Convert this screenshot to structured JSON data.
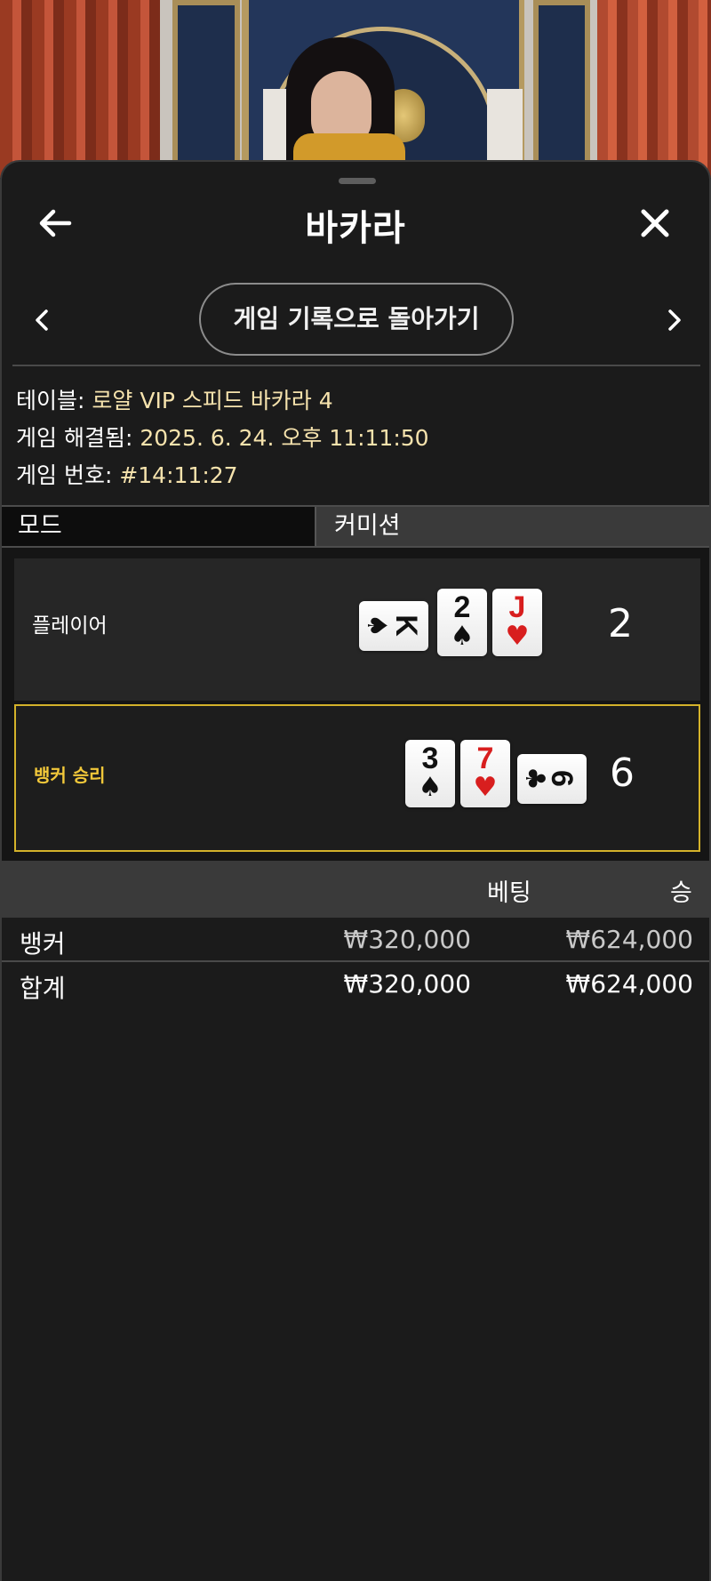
{
  "header": {
    "title": "바카라"
  },
  "nav": {
    "back_to_history_label": "게임 기록으로 돌아가기"
  },
  "info": {
    "table_label": "테이블:",
    "table_value": "로얄 VIP 스피드 바카라 4",
    "resolved_label": "게임 해결됨:",
    "resolved_value": "2025. 6. 24. 오후 11:11:50",
    "number_label": "게임 번호:",
    "number_value": "#14:11:27"
  },
  "tabs": {
    "mode": "모드",
    "commission": "커미션"
  },
  "results": {
    "player": {
      "label": "플레이어",
      "score": "2",
      "cards": [
        {
          "rank": "K",
          "suit": "♠",
          "color": "#111111",
          "orientation": "horizontal"
        },
        {
          "rank": "2",
          "suit": "♠",
          "color": "#111111",
          "orientation": "vertical"
        },
        {
          "rank": "J",
          "suit": "♥",
          "color": "#d81e1e",
          "orientation": "vertical"
        }
      ]
    },
    "banker": {
      "label": "뱅커 승리",
      "score": "6",
      "cards": [
        {
          "rank": "3",
          "suit": "♠",
          "color": "#111111",
          "orientation": "vertical"
        },
        {
          "rank": "7",
          "suit": "♥",
          "color": "#d81e1e",
          "orientation": "vertical"
        },
        {
          "rank": "6",
          "suit": "♣",
          "color": "#111111",
          "orientation": "horizontal"
        }
      ]
    },
    "winner_highlight_color": "#d4b22a"
  },
  "bets": {
    "columns": {
      "bet": "베팅",
      "win": "승"
    },
    "rows": [
      {
        "name": "뱅커",
        "bet": "₩320,000",
        "win": "₩624,000"
      }
    ],
    "total": {
      "name": "합계",
      "bet": "₩320,000",
      "win": "₩624,000"
    }
  },
  "icons": {
    "back": "arrow-left-icon",
    "close": "close-icon",
    "prev": "chevron-left-icon",
    "next": "chevron-right-icon"
  },
  "colors": {
    "accent_text": "#f6e3ad",
    "background": "#1b1b1b"
  }
}
